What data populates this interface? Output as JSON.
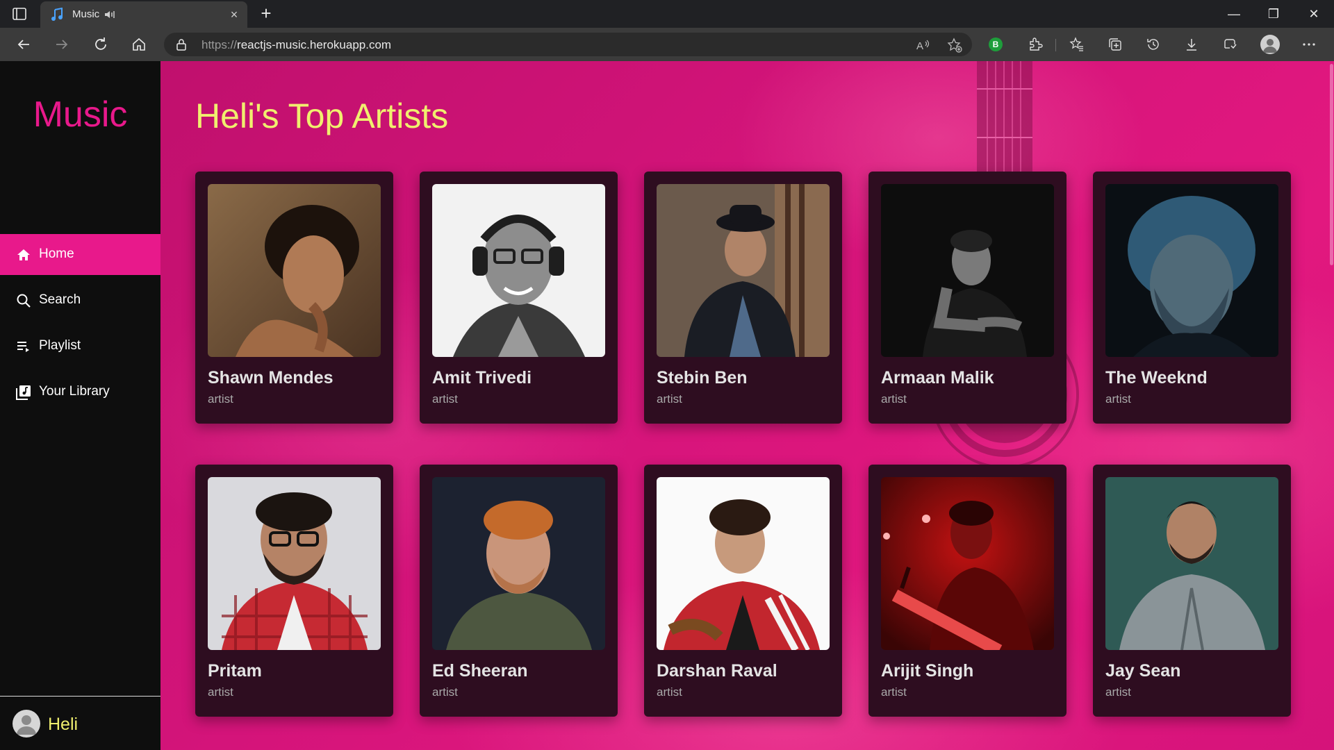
{
  "browser": {
    "tab_title": "Music",
    "url_protocol": "https://",
    "url_host": "reactjs-music.herokuapp.com",
    "extension_badge": "B",
    "window_controls": {
      "minimize": "—",
      "restore": "❐",
      "close": "✕"
    },
    "new_tab": "+",
    "tab_close": "×"
  },
  "sidebar": {
    "logo": "Music",
    "items": [
      {
        "label": "Home",
        "icon": "home-icon",
        "active": true
      },
      {
        "label": "Search",
        "icon": "search-icon",
        "active": false
      },
      {
        "label": "Playlist",
        "icon": "playlist-icon",
        "active": false
      },
      {
        "label": "Your Library",
        "icon": "library-icon",
        "active": false
      }
    ],
    "user": {
      "name": "Heli"
    }
  },
  "main": {
    "title": "Heli's Top Artists",
    "artists": [
      {
        "name": "Shawn Mendes",
        "type": "artist"
      },
      {
        "name": "Amit Trivedi",
        "type": "artist"
      },
      {
        "name": "Stebin Ben",
        "type": "artist"
      },
      {
        "name": "Armaan Malik",
        "type": "artist"
      },
      {
        "name": "The Weeknd",
        "type": "artist"
      },
      {
        "name": "Pritam",
        "type": "artist"
      },
      {
        "name": "Ed Sheeran",
        "type": "artist"
      },
      {
        "name": "Darshan Raval",
        "type": "artist"
      },
      {
        "name": "Arijit Singh",
        "type": "artist"
      },
      {
        "name": "Jay Sean",
        "type": "artist"
      }
    ]
  },
  "colors": {
    "accent": "#e8198b",
    "title_yellow": "#f0ef6e",
    "sidebar_bg": "#0e0e0e",
    "card_bg": "#2e0d20"
  }
}
